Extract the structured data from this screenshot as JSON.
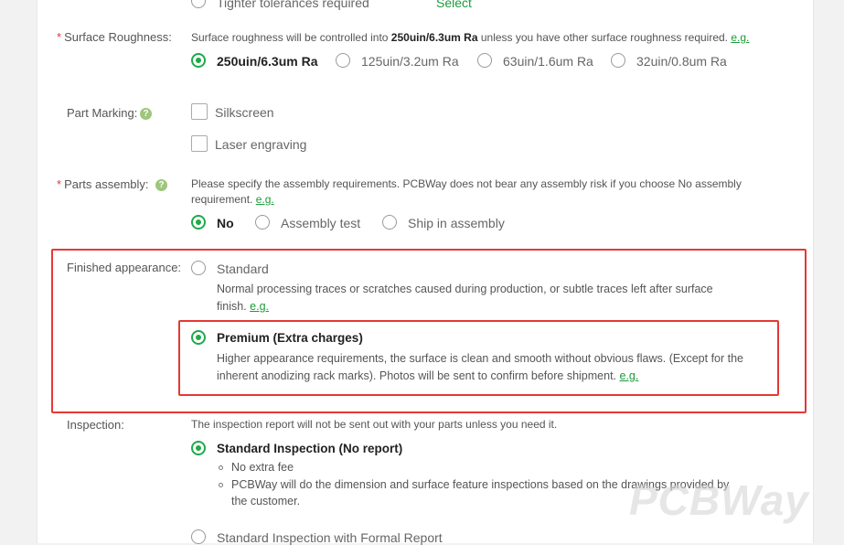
{
  "top": {
    "partial_option": "Tighter tolerances required",
    "partial_select": "Select"
  },
  "surface": {
    "label": "Surface Roughness:",
    "desc_pre": "Surface roughness will be controlled into ",
    "desc_strong": "250uin/6.3um Ra",
    "desc_post": " unless you have other surface roughness required.",
    "eg": "e.g.",
    "options": [
      "250uin/6.3um Ra",
      "125uin/3.2um Ra",
      "63uin/1.6um Ra",
      "32uin/0.8um Ra"
    ]
  },
  "marking": {
    "label": "Part Marking:",
    "options": [
      "Silkscreen",
      "Laser engraving"
    ]
  },
  "assembly": {
    "label": "Parts assembly:",
    "desc_line1": "Please specify the assembly requirements. PCBWay does not bear any assembly risk if you choose No assembly",
    "desc_line2": "requirement.",
    "eg": "e.g.",
    "options": [
      "No",
      "Assembly test",
      "Ship in assembly"
    ]
  },
  "finish": {
    "label": "Finished appearance:",
    "standard": {
      "title": "Standard",
      "desc_line1": "Normal processing traces or scratches caused during production, or subtle traces left after surface",
      "desc_line2": "finish.",
      "eg": "e.g."
    },
    "premium": {
      "title": "Premium (Extra charges)",
      "desc_line1": "Higher appearance requirements, the surface is clean and smooth without obvious flaws. (Except for the",
      "desc_line2": "inherent anodizing rack marks). Photos will be sent to confirm before shipment.",
      "eg": "e.g."
    }
  },
  "inspection": {
    "label": "Inspection:",
    "desc": "The inspection report will not be sent out with your parts unless you need it.",
    "standard_title": "Standard Inspection (No report)",
    "bullets": [
      "No extra fee",
      "PCBWay will do the dimension and surface feature inspections based on the drawings provided by"
    ],
    "bullet2_cont": "the customer.",
    "formal_title": "Standard Inspection with Formal Report"
  },
  "watermark": "PCBWay",
  "colors": {
    "accent": "#1faa4a",
    "highlight": "#e53935",
    "link": "#1a9c3a"
  }
}
